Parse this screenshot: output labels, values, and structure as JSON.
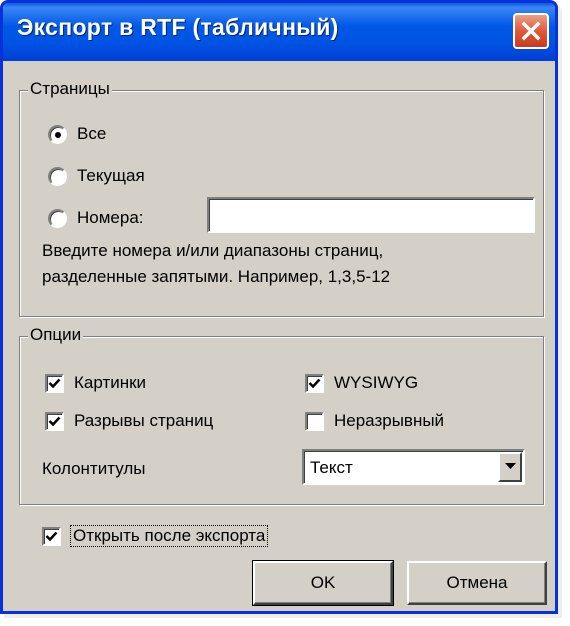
{
  "window": {
    "title": "Экспорт в RTF (табличный)"
  },
  "pages": {
    "legend": "Страницы",
    "options": [
      {
        "label": "Все",
        "checked": true
      },
      {
        "label": "Текущая",
        "checked": false
      },
      {
        "label": "Номера:",
        "checked": false
      }
    ],
    "numbers_value": "",
    "help_line1": "Введите номера и/или диапазоны страниц,",
    "help_line2": "разделенные запятыми. Например, 1,3,5-12"
  },
  "options": {
    "legend": "Опции",
    "pictures": {
      "label": "Картинки",
      "checked": true
    },
    "page_breaks": {
      "label": "Разрывы страниц",
      "checked": true
    },
    "wysiwyg": {
      "label": "WYSIWYG",
      "checked": true
    },
    "continuous": {
      "label": "Неразрывный",
      "checked": false
    },
    "headers_label": "Колонтитулы",
    "headers_value": "Текст"
  },
  "open_after": {
    "label": "Открыть после экспорта",
    "checked": true
  },
  "buttons": {
    "ok": "OK",
    "cancel": "Отмена"
  },
  "icons": {
    "close": "close-icon",
    "check": "check-icon",
    "dropdown": "chevron-down-icon"
  }
}
